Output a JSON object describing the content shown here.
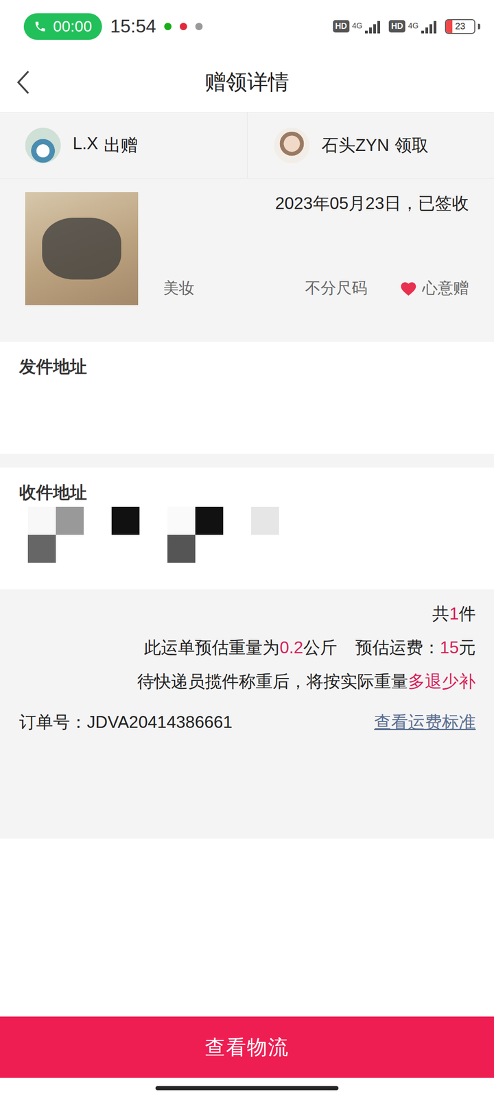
{
  "status_bar": {
    "call_timer": "00:00",
    "time": "15:54",
    "networks": [
      {
        "hd": "HD",
        "type": "4G",
        "bars": 4
      },
      {
        "hd": "HD",
        "type": "4G",
        "bars": 4
      }
    ],
    "battery": "23",
    "battery_level": 0.23
  },
  "header": {
    "title": "赠领详情"
  },
  "parties": [
    {
      "name": "L.X",
      "action": "出赠"
    },
    {
      "name": "石头ZYN",
      "action": "领取"
    }
  ],
  "item": {
    "status": "2023年05月23日，已签收",
    "category": "美妆",
    "size": "不分尺码",
    "tag": "心意赠"
  },
  "sender_address": {
    "label": "发件地址"
  },
  "receiver_address": {
    "label": "收件地址"
  },
  "summary": {
    "count_prefix": "共",
    "count": "1",
    "count_suffix": "件",
    "weight_prefix": "此运单预估重量为",
    "weight": "0.2",
    "weight_unit": "公斤",
    "fee_label": "预估运费：",
    "fee": "15",
    "fee_unit": "元",
    "note": "待快递员揽件称重后，将按实际重量",
    "note_highlight": "多退少补",
    "order_label": "订单号：",
    "order_no": "JDVA20414386661",
    "fee_standard_link": "查看运费标准"
  },
  "primary_button": "查看物流"
}
